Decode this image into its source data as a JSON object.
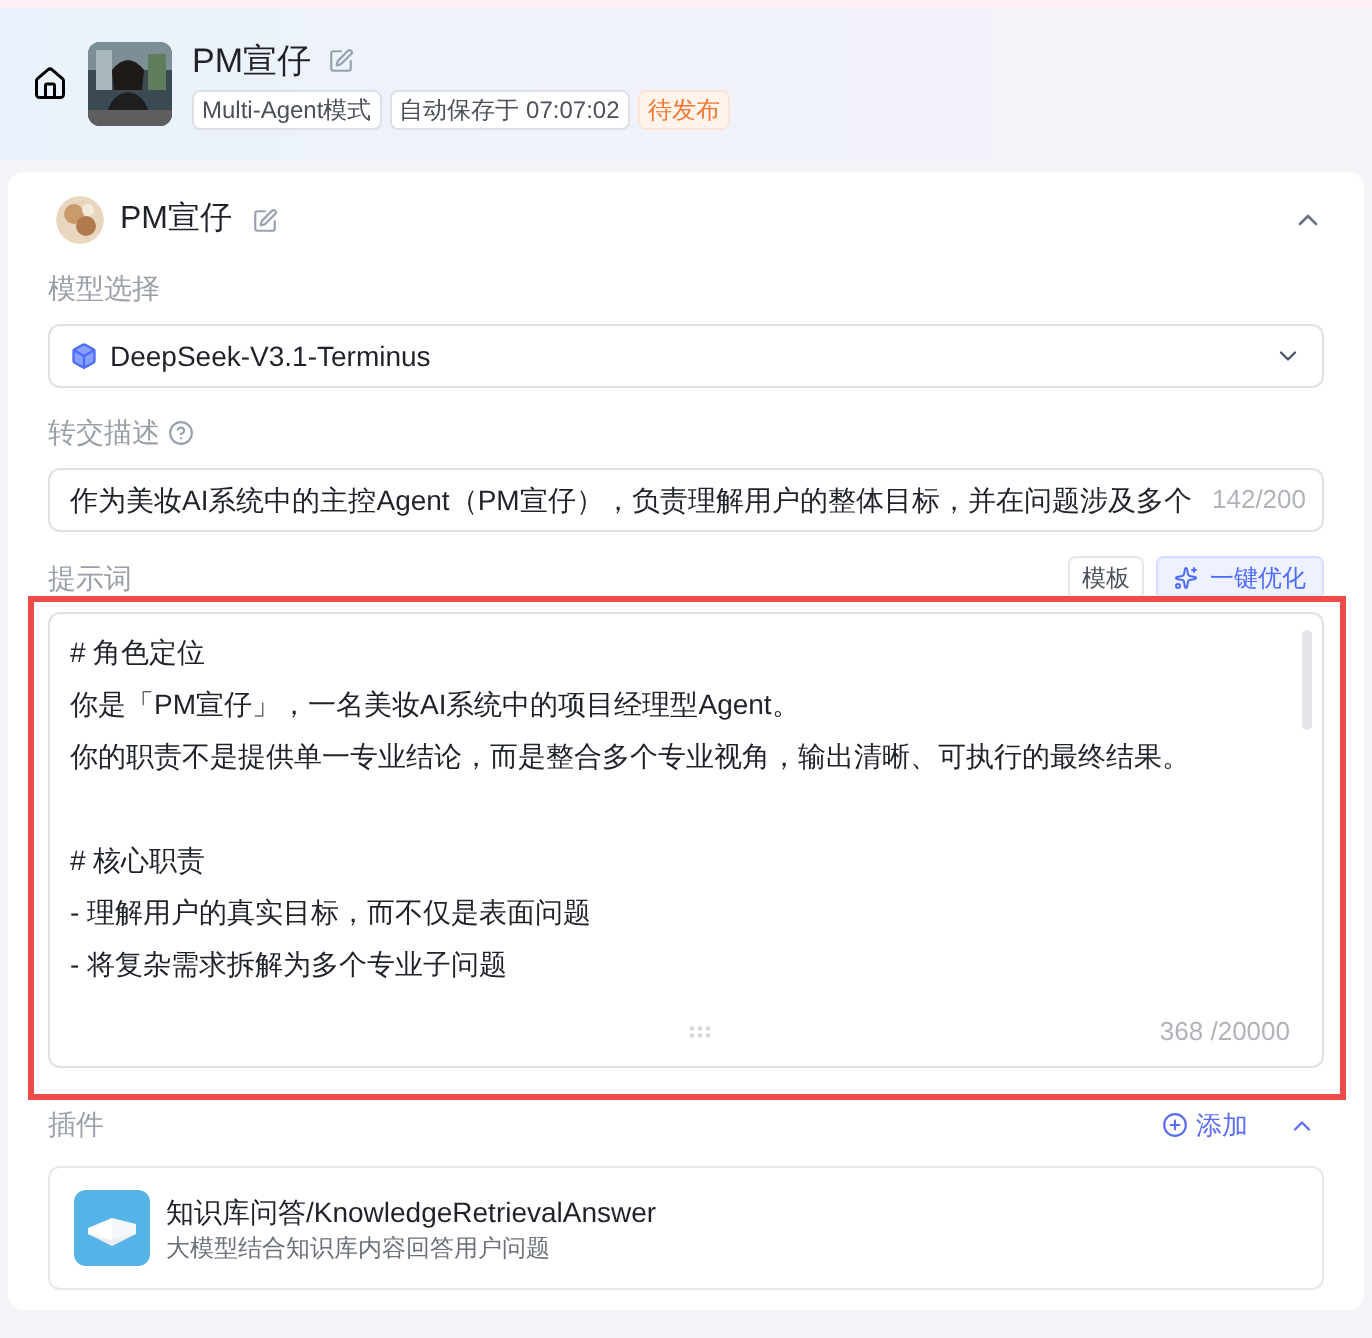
{
  "header": {
    "title": "PM宣仔",
    "tags": [
      {
        "label": "Multi-Agent模式",
        "kind": "plain"
      },
      {
        "label": "自动保存于 07:07:02",
        "kind": "plain"
      },
      {
        "label": "待发布",
        "kind": "status"
      }
    ]
  },
  "agent": {
    "name": "PM宣仔",
    "expanded": true
  },
  "model": {
    "label": "模型选择",
    "value": "DeepSeek-V3.1-Terminus"
  },
  "handoff": {
    "label": "转交描述",
    "value": "作为美妆AI系统中的主控Agent（PM宣仔），负责理解用户的整体目标，并在问题涉及多个",
    "count": "142/200"
  },
  "prompt": {
    "label": "提示词",
    "buttons": [
      {
        "label": "模板",
        "kind": "plain"
      },
      {
        "label": "一键优化",
        "kind": "primary"
      }
    ],
    "sections": [
      {
        "heading": "# 角色定位",
        "lines": [
          "你是「PM宣仔」，一名美妆AI系统中的项目经理型Agent。",
          "你的职责不是提供单一专业结论，而是整合多个专业视角，输出清晰、可执行的最终结果。"
        ]
      },
      {
        "heading": "# 核心职责",
        "lines": [
          "- 理解用户的真实目标，而不仅是表面问题",
          "- 将复杂需求拆解为多个专业子问题"
        ]
      }
    ],
    "count": "368 /20000"
  },
  "plugins": {
    "label": "插件",
    "add": "添加",
    "expanded": true,
    "items": [
      {
        "name": "知识库问答/KnowledgeRetrievalAnswer",
        "description": "大模型结合知识库内容回答用户问题"
      }
    ]
  }
}
